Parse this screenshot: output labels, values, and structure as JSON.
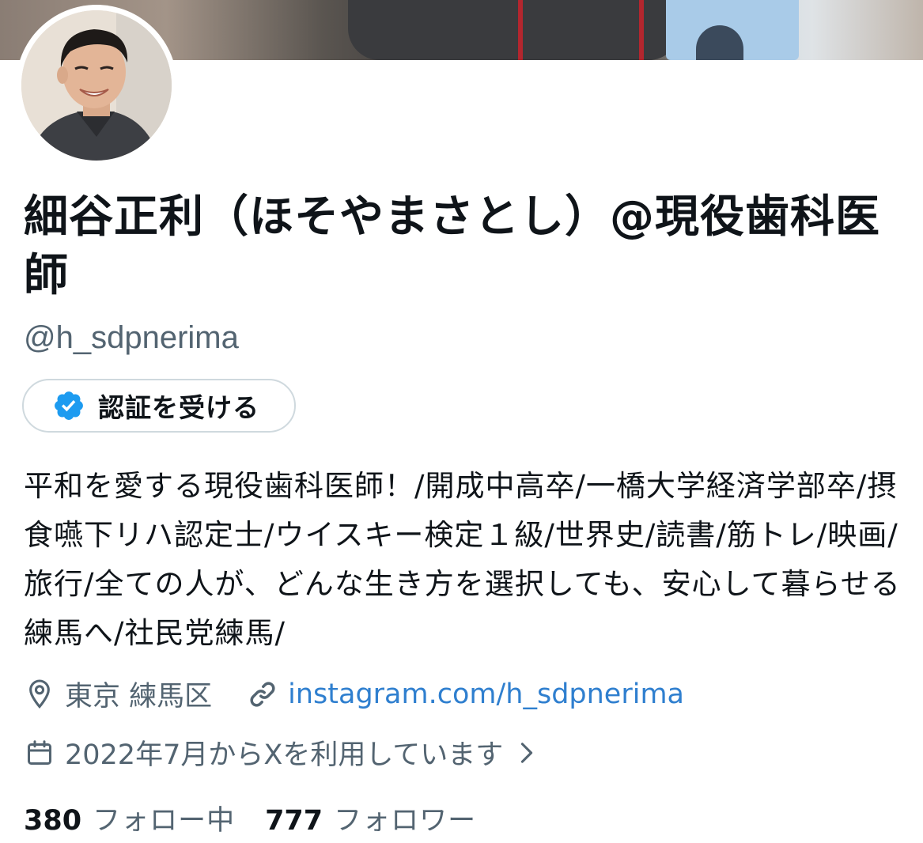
{
  "profile": {
    "display_name": "細谷正利（ほそやまさとし）@現役歯科医師",
    "handle": "@h_sdpnerima",
    "verify_button_label": "認証を受ける",
    "bio": "平和を愛する現役歯科医師！/開成中高卒/一橋大学経済学部卒/摂食嚥下リハ認定士/ウイスキー検定１級/世界史/読書/筋トレ/映画/旅行/全ての人が、どんな生き方を選択しても、安心して暮らせる練馬へ/社民党練馬/",
    "location": "東京 練馬区",
    "website": "instagram.com/h_sdpnerima",
    "joined": "2022年7月からXを利用しています",
    "following_count": "380",
    "following_label": "フォロー中",
    "followers_count": "777",
    "followers_label": "フォロワー"
  },
  "colors": {
    "text_primary": "#0f1419",
    "text_secondary": "#536471",
    "link": "#2f7fcf",
    "verified_badge": "#1d9bf0",
    "button_border": "#cfd9de"
  },
  "icons": {
    "verify": "verified-badge-icon",
    "location": "location-pin-icon",
    "website": "link-icon",
    "joined": "calendar-icon",
    "more": "chevron-right-icon"
  }
}
